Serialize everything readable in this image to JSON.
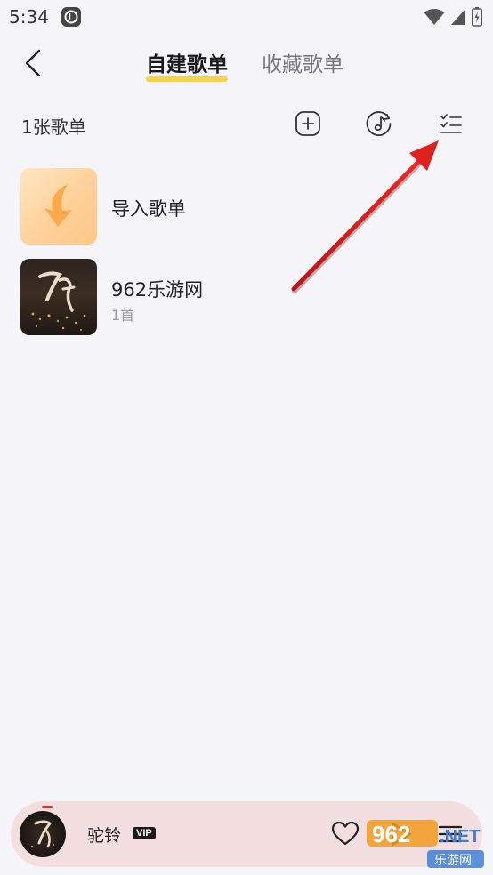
{
  "status_bar": {
    "time": "5:34"
  },
  "header": {
    "tabs": [
      {
        "label": "自建歌单",
        "active": true
      },
      {
        "label": "收藏歌单",
        "active": false
      }
    ]
  },
  "toolbar": {
    "count_label": "1张歌单"
  },
  "playlists": [
    {
      "title": "导入歌单",
      "subtitle": ""
    },
    {
      "title": "962乐游网",
      "subtitle": "1首"
    }
  ],
  "mini_player": {
    "song_title": "驼铃",
    "badge": "VIP"
  },
  "watermark": {
    "brand": "962",
    "suffix": ".NET",
    "caption": "乐游网"
  },
  "colors": {
    "accent_underline": "#f6d348",
    "background": "#f5f5f9",
    "player_bg": "#f3dfe0",
    "arrow": "#e0221f"
  }
}
